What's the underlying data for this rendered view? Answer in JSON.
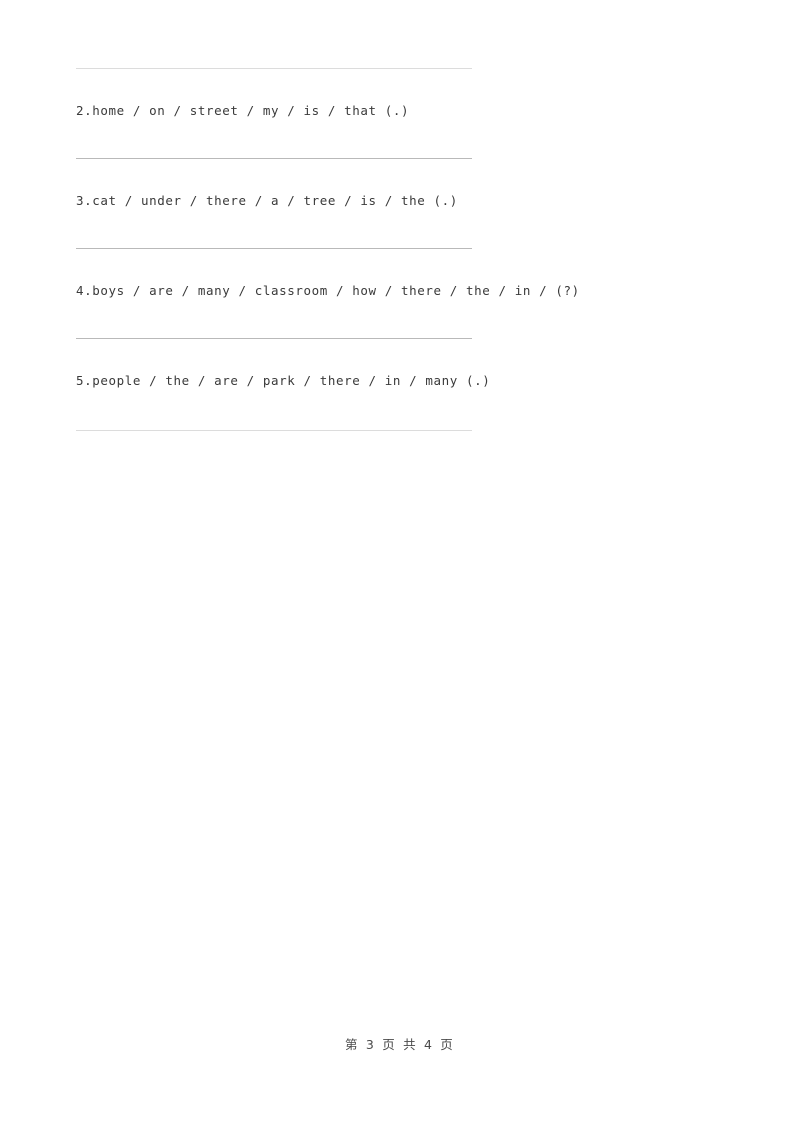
{
  "document": {
    "type": "worksheet",
    "language": "en-zh",
    "background_color": "#ffffff",
    "text_color": "#3a3a3a",
    "rule_color": "#b9b9b9",
    "rule_color_faint": "#dcdcdc"
  },
  "questions": [
    {
      "number": "2.",
      "text": "2.home / on / street / my / is / that (.)",
      "words": [
        "home",
        "on",
        "street",
        "my",
        "is",
        "that"
      ],
      "end_mark": "(.)"
    },
    {
      "number": "3.",
      "text": "3.cat / under / there / a / tree / is / the (.)",
      "words": [
        "cat",
        "under",
        "there",
        "a",
        "tree",
        "is",
        "the"
      ],
      "end_mark": "(.)"
    },
    {
      "number": "4.",
      "text": "4.boys / are / many / classroom / how / there / the / in / (?)",
      "words": [
        "boys",
        "are",
        "many",
        "classroom",
        "how",
        "there",
        "the",
        "in"
      ],
      "end_mark": "(?)"
    },
    {
      "number": "5.",
      "text": "5.people / the / are / park / there / in / many (.)",
      "words": [
        "people",
        "the",
        "are",
        "park",
        "there",
        "in",
        "many"
      ],
      "end_mark": "(.)"
    }
  ],
  "footer": {
    "page_label": "第 3 页 共 4 页",
    "current_page": 3,
    "total_pages": 4
  }
}
